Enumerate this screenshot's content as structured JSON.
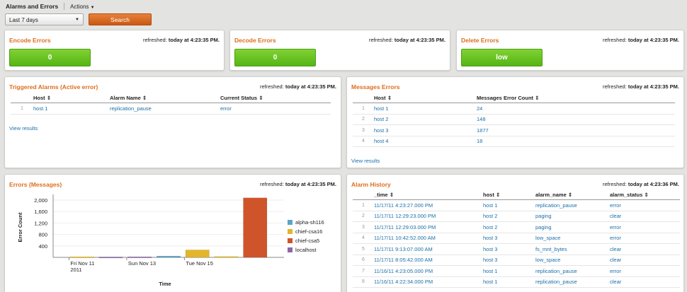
{
  "app": {
    "title": "Alarms and Errors",
    "actions_label": "Actions"
  },
  "controls": {
    "timerange": "Last 7 days",
    "search_label": "Search"
  },
  "refresh": {
    "prefix": "refreshed:",
    "time1": "today at 4:23:35 PM.",
    "time2": "today at 4:23:36 PM."
  },
  "encode": {
    "title": "Encode Errors",
    "value": "0"
  },
  "decode": {
    "title": "Decode Errors",
    "value": "0"
  },
  "delete": {
    "title": "Delete Errors",
    "value": "low"
  },
  "triggered": {
    "title": "Triggered Alarms (Active error)",
    "columns": [
      "Host",
      "Alarm Name",
      "Current Status"
    ],
    "rows": [
      [
        "host 1",
        "replication_pause",
        "error"
      ]
    ],
    "view_results": "View results"
  },
  "messages": {
    "title": "Messages Errors",
    "columns": [
      "Host",
      "Messages Error Count"
    ],
    "rows": [
      [
        "host 1",
        "24"
      ],
      [
        "host 2",
        "148"
      ],
      [
        "host 3",
        "1877"
      ],
      [
        "host 4",
        "18"
      ]
    ],
    "view_results": "View results"
  },
  "history": {
    "title": "Alarm History",
    "columns": [
      "_time",
      "host",
      "alarm_name",
      "alarm_status"
    ],
    "rows": [
      [
        "11/17/11 4:23:27.000 PM",
        "host 1",
        "replication_pause",
        "error"
      ],
      [
        "11/17/11 12:29:23.000 PM",
        "host 2",
        "paging",
        "clear"
      ],
      [
        "11/17/11 12:29:03.000 PM",
        "host 2",
        "paging",
        "error"
      ],
      [
        "11/17/11 10:42:52.000 AM",
        "host 3",
        "low_space",
        "error"
      ],
      [
        "11/17/11 9:13:07.000 AM",
        "host 3",
        "fs_mnt_bytes",
        "clear"
      ],
      [
        "11/17/11 8:05:42.000 AM",
        "host 3",
        "low_space",
        "clear"
      ],
      [
        "11/16/11 4:23:05.000 PM",
        "host 1",
        "replication_pause",
        "error"
      ],
      [
        "11/16/11 4:22:34.000 PM",
        "host 1",
        "replication_pause",
        "clear"
      ]
    ]
  },
  "errors_chart": {
    "title": "Errors (Messages)"
  },
  "chart_data": {
    "type": "bar",
    "xlabel": "Time",
    "ylabel": "Error Count",
    "ylim": [
      0,
      2100
    ],
    "yticks": [
      "400",
      "800",
      "1,200",
      "1,600",
      "2,000"
    ],
    "xticks": [
      "Fri Nov 11\n2011",
      "Sun Nov 13",
      "Tue Nov 15"
    ],
    "legend_position": "right",
    "series": [
      {
        "name": "alpha-sh116",
        "color": "#5aa6c8"
      },
      {
        "name": "chief-csa16",
        "color": "#e3b52a"
      },
      {
        "name": "chief-csa5",
        "color": "#d0542a"
      },
      {
        "name": "localhost",
        "color": "#8a6aa6"
      }
    ],
    "bars": [
      {
        "day": 0,
        "series": 1,
        "value": 20
      },
      {
        "day": 1,
        "series": 3,
        "value": 15
      },
      {
        "day": 2,
        "series": 3,
        "value": 20
      },
      {
        "day": 3,
        "series": 0,
        "value": 45
      },
      {
        "day": 4,
        "series": 1,
        "value": 260
      },
      {
        "day": 5,
        "series": 1,
        "value": 30
      },
      {
        "day": 6,
        "series": 2,
        "value": 2080
      }
    ]
  }
}
